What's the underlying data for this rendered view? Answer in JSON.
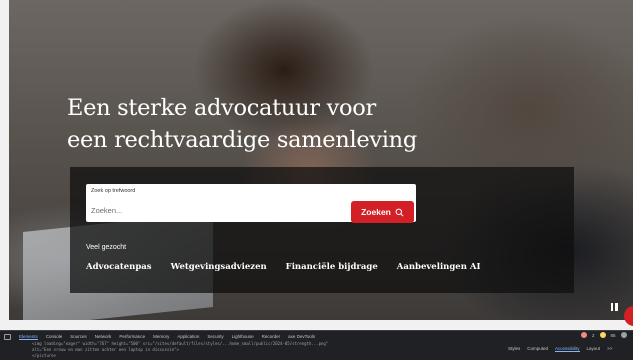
{
  "hero": {
    "headline_line1": "Een sterke advocatuur voor",
    "headline_line2": "een rechtvaardige samenleving"
  },
  "search": {
    "label": "Zoek op trefwoord",
    "placeholder": "Zoeken...",
    "button_label": "Zoeken"
  },
  "popular": {
    "title": "Veel gezocht",
    "links": [
      "Advocatenpas",
      "Wetgevingsadviezen",
      "Financiële bijdrage",
      "Aanbevelingen AI"
    ]
  },
  "devtools": {
    "tabs": [
      "Elements",
      "Console",
      "Sources",
      "Network",
      "Performance",
      "Memory",
      "Application",
      "Security",
      "Lighthouse",
      "Recorder",
      "axe DevTools"
    ],
    "code_line1": "<img loading=\"eager\" width=\"767\" height=\"500\" src=\"/sites/default/files/styles/...home_small/public/2024-05/strength...png\"",
    "code_line2": "alt=\"Een vrouw en man zitten achter een laptop in discussie\">",
    "code_line3": "</picture>",
    "right_tabs": [
      "Styles",
      "Computed",
      "Accessibility",
      "Layout"
    ],
    "right_tab_more": ">>",
    "error_count": "2",
    "warning_count": "85"
  },
  "colors": {
    "brand_red": "#d31f26",
    "devtools_bg": "#202124",
    "devtools_accent": "#8ab4f8"
  }
}
